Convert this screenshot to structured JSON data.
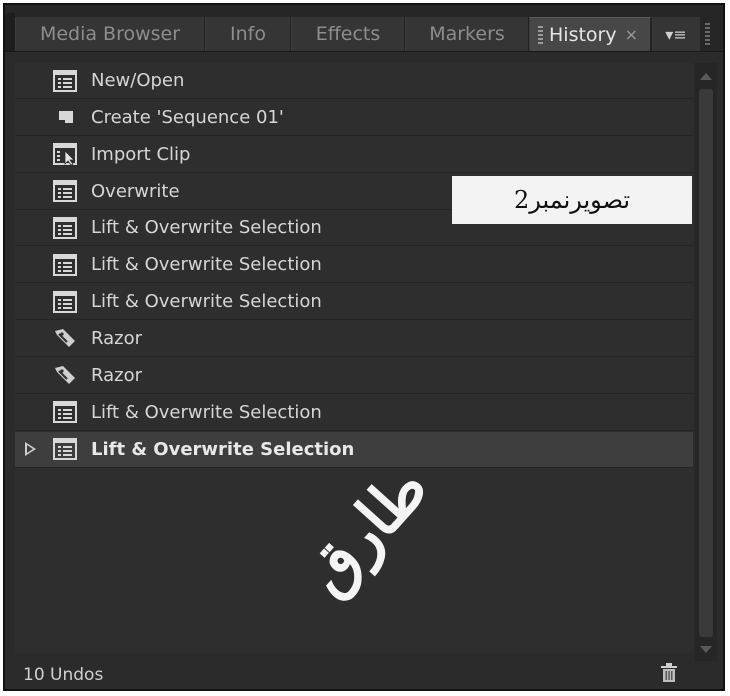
{
  "tabs": [
    {
      "label": "Media Browser",
      "active": false
    },
    {
      "label": "Info",
      "active": false
    },
    {
      "label": "Effects",
      "active": false
    },
    {
      "label": "Markers",
      "active": false
    },
    {
      "label": "History",
      "active": true,
      "close": "×"
    }
  ],
  "panel_menu_glyph": "▾≡",
  "history": [
    {
      "label": "New/Open",
      "icon": "list-document-icon"
    },
    {
      "label": "Create 'Sequence 01'",
      "icon": "sequence-icon"
    },
    {
      "label": "Import Clip",
      "icon": "import-clip-icon"
    },
    {
      "label": "Overwrite",
      "icon": "list-document-icon"
    },
    {
      "label": "Lift & Overwrite Selection",
      "icon": "list-document-icon"
    },
    {
      "label": "Lift & Overwrite Selection",
      "icon": "list-document-icon"
    },
    {
      "label": "Lift & Overwrite Selection",
      "icon": "list-document-icon"
    },
    {
      "label": "Razor",
      "icon": "razor-icon"
    },
    {
      "label": "Razor",
      "icon": "razor-icon"
    },
    {
      "label": "Lift & Overwrite Selection",
      "icon": "list-document-icon"
    },
    {
      "label": "Lift & Overwrite Selection",
      "icon": "list-document-icon",
      "current": true
    }
  ],
  "status": {
    "undo_count": "10 Undos",
    "trash_icon": "trash-icon"
  },
  "overlay": {
    "caption": "تصویرنمبر2"
  },
  "watermark": {
    "text": "طارق"
  },
  "colors": {
    "panel_bg": "#2e2e2e",
    "current_row_bg": "#3e3e3e",
    "text": "#d6d6d6"
  }
}
